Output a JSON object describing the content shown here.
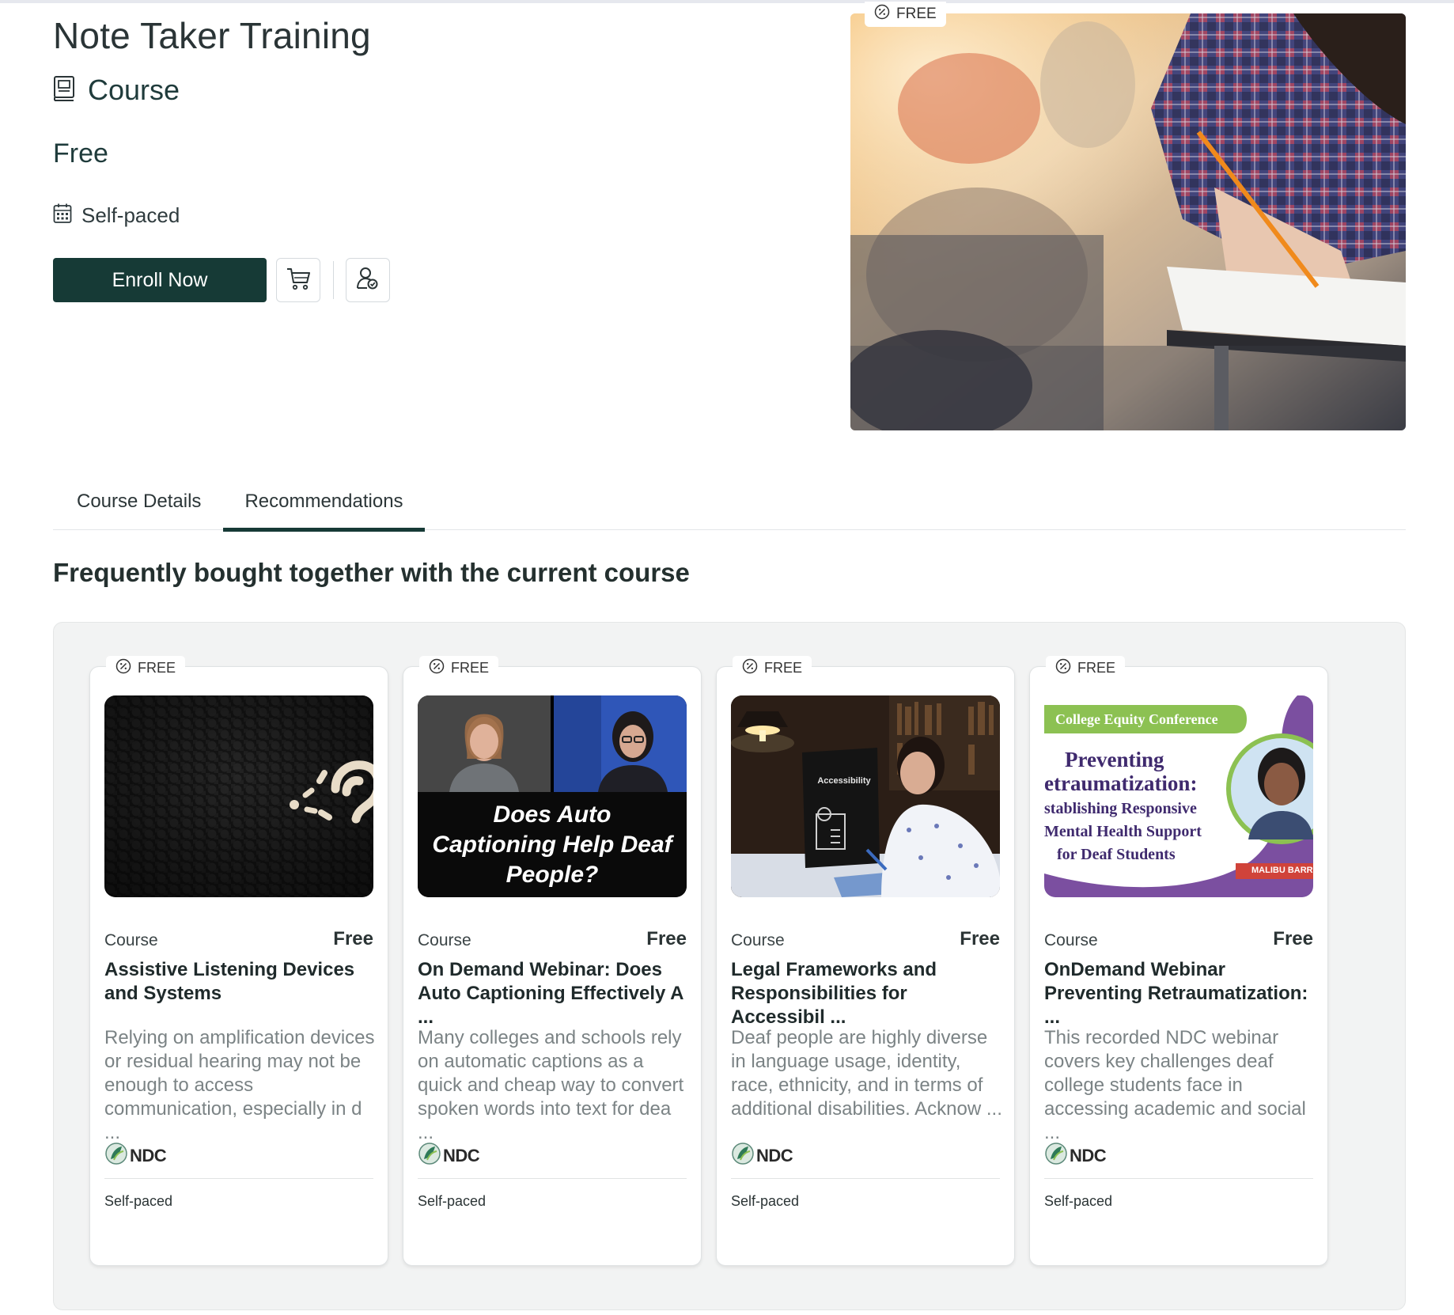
{
  "course": {
    "title": "Note Taker Training",
    "type_label": "Course",
    "price": "Free",
    "pace": "Self-paced",
    "enroll_label": "Enroll Now",
    "badge": "FREE"
  },
  "tabs": [
    {
      "label": "Course Details",
      "active": false
    },
    {
      "label": "Recommendations",
      "active": true
    }
  ],
  "section_title": "Frequently bought together with the current course",
  "cards": [
    {
      "badge": "FREE",
      "type": "Course",
      "price": "Free",
      "title": "Assistive Listening Devices and Systems",
      "description": "Relying on amplification devices or residual hearing may not be enough to access communication, especially in d ...",
      "provider": "NDC",
      "pace": "Self-paced"
    },
    {
      "badge": "FREE",
      "type": "Course",
      "price": "Free",
      "title": "On Demand Webinar: Does Auto Captioning Effectively A ...",
      "description": "Many colleges and schools rely on automatic captions as a quick and cheap way to convert spoken words into text for dea ...",
      "provider": "NDC",
      "pace": "Self-paced",
      "image_text": "Does Auto Captioning Help Deaf People?"
    },
    {
      "badge": "FREE",
      "type": "Course",
      "price": "Free",
      "title": "Legal Frameworks and Responsibilities for Accessibil ...",
      "description": "Deaf people are highly diverse in language usage, identity, race, ethnicity, and in terms of additional disabilities. Acknow ...",
      "provider": "NDC",
      "pace": "Self-paced",
      "image_text": "Accessibility"
    },
    {
      "badge": "FREE",
      "type": "Course",
      "price": "Free",
      "title": "OnDemand Webinar Preventing Retraumatization: ...",
      "description": "This recorded NDC webinar covers key challenges deaf college students face in accessing academic and social ...",
      "provider": "NDC",
      "pace": "Self-paced",
      "image_banner": "College Equity Conference",
      "image_lines": [
        "Preventing",
        "etraumatization:",
        "stablishing Responsive",
        "Mental Health Support",
        "for Deaf Students"
      ],
      "image_name_tag": "MALIBU BARR"
    }
  ],
  "colors": {
    "primary": "#163a36",
    "panel_bg": "#f2f3f3",
    "muted_text": "#7b8385",
    "conference_green": "#8cc152",
    "conference_purple": "#7b4fa0"
  }
}
